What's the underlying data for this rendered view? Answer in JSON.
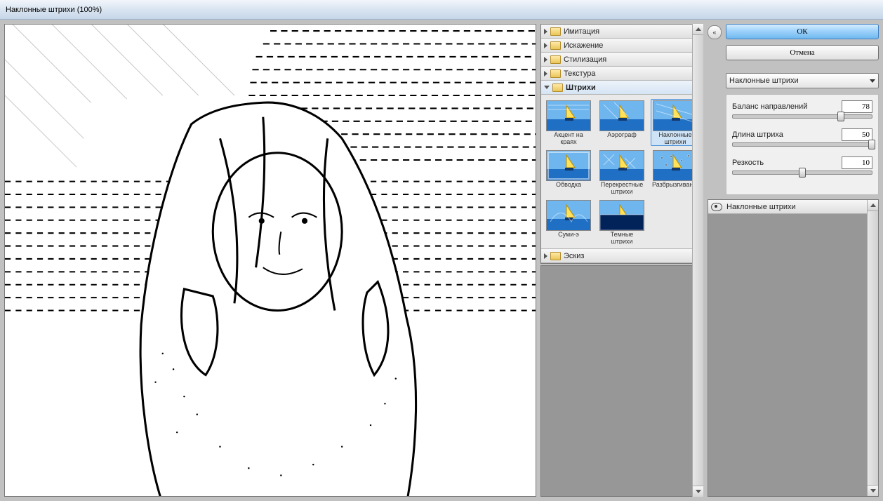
{
  "title": "Наклонные штрихи (100%)",
  "actions": {
    "ok": "ОК",
    "cancel": "Отмена"
  },
  "filter_select": "Наклонные штрихи",
  "categories": [
    {
      "label": "Имитация",
      "open": false
    },
    {
      "label": "Искажение",
      "open": false
    },
    {
      "label": "Стилизация",
      "open": false
    },
    {
      "label": "Текстура",
      "open": false
    },
    {
      "label": "Штрихи",
      "open": true
    },
    {
      "label": "Эскиз",
      "open": false
    }
  ],
  "thumbs": [
    {
      "label": "Акцент на краях"
    },
    {
      "label": "Аэрограф"
    },
    {
      "label": "Наклонные штрихи",
      "selected": true
    },
    {
      "label": "Обводка"
    },
    {
      "label": "Перекрестные штрихи"
    },
    {
      "label": "Разбрызгивание"
    },
    {
      "label": "Суми-э"
    },
    {
      "label": "Темные штрихи"
    }
  ],
  "params": [
    {
      "label": "Баланс направлений",
      "value": 78,
      "min": 0,
      "max": 100
    },
    {
      "label": "Длина штриха",
      "value": 50,
      "min": 0,
      "max": 50
    },
    {
      "label": "Резкость",
      "value": 10,
      "min": 0,
      "max": 20
    }
  ],
  "layer": {
    "label": "Наклонные штрихи"
  }
}
